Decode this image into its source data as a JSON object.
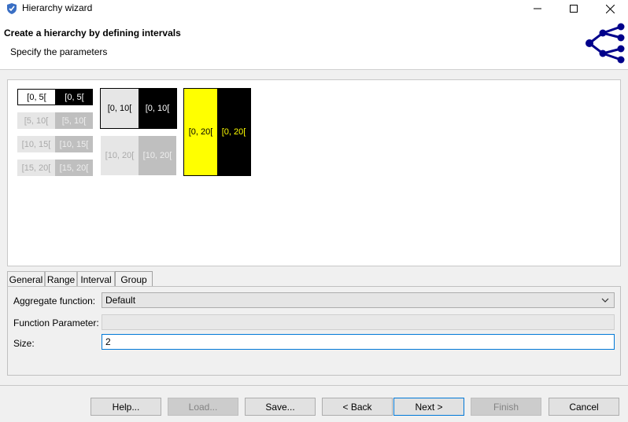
{
  "window": {
    "title": "Hierarchy wizard",
    "controls": [
      "minimize",
      "maximize",
      "close"
    ]
  },
  "header": {
    "title": "Create a hierarchy by defining intervals",
    "subtitle": "Specify the parameters",
    "icon": "hierarchy-tree-icon",
    "icon_color": "#00008b"
  },
  "preview": {
    "level1": [
      {
        "left": "[0, 5[",
        "right": "[0, 5["
      },
      {
        "left": "[5, 10[",
        "right": "[5, 10["
      },
      {
        "left": "[10, 15[",
        "right": "[10, 15["
      },
      {
        "left": "[15, 20[",
        "right": "[15, 20["
      }
    ],
    "level2": [
      {
        "left": "[0, 10[",
        "right": "[0, 10["
      },
      {
        "left": "[10, 20[",
        "right": "[10, 20["
      }
    ],
    "level3": [
      {
        "left": "[0, 20[",
        "right": "[0, 20["
      }
    ],
    "colors": {
      "highlight_yellow": "#ffff00",
      "black": "#000000",
      "inactive_light": "#e6e6e6",
      "inactive_mid": "#bfbfbf"
    }
  },
  "tabs": [
    {
      "label": "General",
      "active": false
    },
    {
      "label": "Range",
      "active": false
    },
    {
      "label": "Interval",
      "active": false
    },
    {
      "label": "Group",
      "active": true
    }
  ],
  "form": {
    "aggregate_label": "Aggregate function:",
    "aggregate_value": "Default",
    "param_label": "Function Parameter:",
    "param_value": "",
    "size_label": "Size:",
    "size_value": "2"
  },
  "buttons": {
    "help": "Help...",
    "load": "Load...",
    "save": "Save...",
    "back": "< Back",
    "next": "Next >",
    "finish": "Finish",
    "cancel": "Cancel"
  }
}
